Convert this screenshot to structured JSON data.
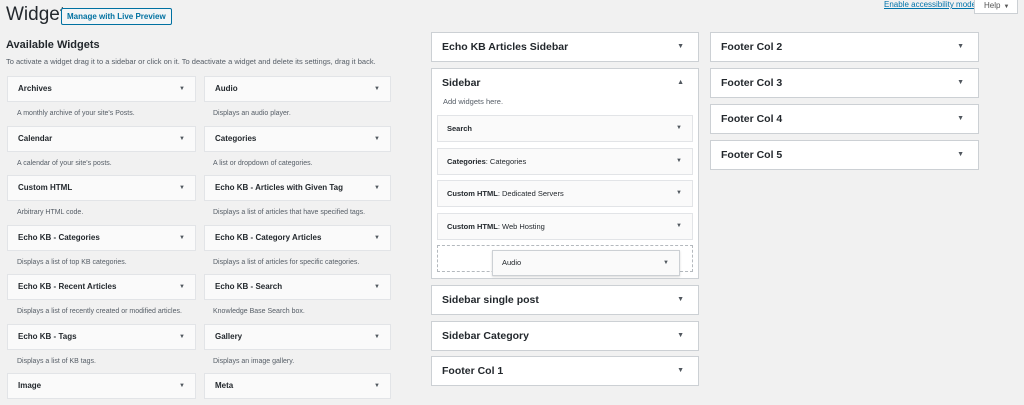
{
  "header": {
    "title": "Widgets",
    "live_preview": "Manage with Live Preview",
    "accessibility": "Enable accessibility mode",
    "help": "Help"
  },
  "available": {
    "title": "Available Widgets",
    "description": "To activate a widget drag it to a sidebar or click on it. To deactivate a widget and delete its settings, drag it back.",
    "widgets": [
      {
        "name": "Archives",
        "desc": "A monthly archive of your site's Posts."
      },
      {
        "name": "Audio",
        "desc": "Displays an audio player."
      },
      {
        "name": "Calendar",
        "desc": "A calendar of your site's posts."
      },
      {
        "name": "Categories",
        "desc": "A list or dropdown of categories."
      },
      {
        "name": "Custom HTML",
        "desc": "Arbitrary HTML code."
      },
      {
        "name": "Echo KB - Articles with Given Tag",
        "desc": "Displays a list of articles that have specified tags."
      },
      {
        "name": "Echo KB - Categories",
        "desc": "Displays a list of top KB categories."
      },
      {
        "name": "Echo KB - Category Articles",
        "desc": "Displays a list of articles for specific categories."
      },
      {
        "name": "Echo KB - Recent Articles",
        "desc": "Displays a list of recently created or modified articles."
      },
      {
        "name": "Echo KB - Search",
        "desc": "Knowledge Base Search box."
      },
      {
        "name": "Echo KB - Tags",
        "desc": "Displays a list of KB tags."
      },
      {
        "name": "Gallery",
        "desc": "Displays an image gallery."
      },
      {
        "name": "Image",
        "desc": ""
      },
      {
        "name": "Meta",
        "desc": ""
      }
    ]
  },
  "areas": {
    "echo_kb": "Echo KB Articles Sidebar",
    "sidebar": {
      "title": "Sidebar",
      "empty_hint": "Add widgets here.",
      "items": [
        {
          "type": "Search",
          "title": ""
        },
        {
          "type": "Categories",
          "title": ": Categories"
        },
        {
          "type": "Custom HTML",
          "title": ": Dedicated Servers"
        },
        {
          "type": "Custom HTML",
          "title": ": Web Hosting"
        }
      ]
    },
    "sidebar_single": "Sidebar single post",
    "sidebar_category": "Sidebar Category",
    "footer1": "Footer Col 1",
    "footer2": "Footer Col 2",
    "footer3": "Footer Col 3",
    "footer4": "Footer Col 4",
    "footer5": "Footer Col 5"
  },
  "dragging": "Audio",
  "icons": {
    "collapse": "caret-down-icon",
    "expand": "caret-up-icon"
  },
  "colors": {
    "link": "#0073aa",
    "button_border": "#0071a1"
  }
}
